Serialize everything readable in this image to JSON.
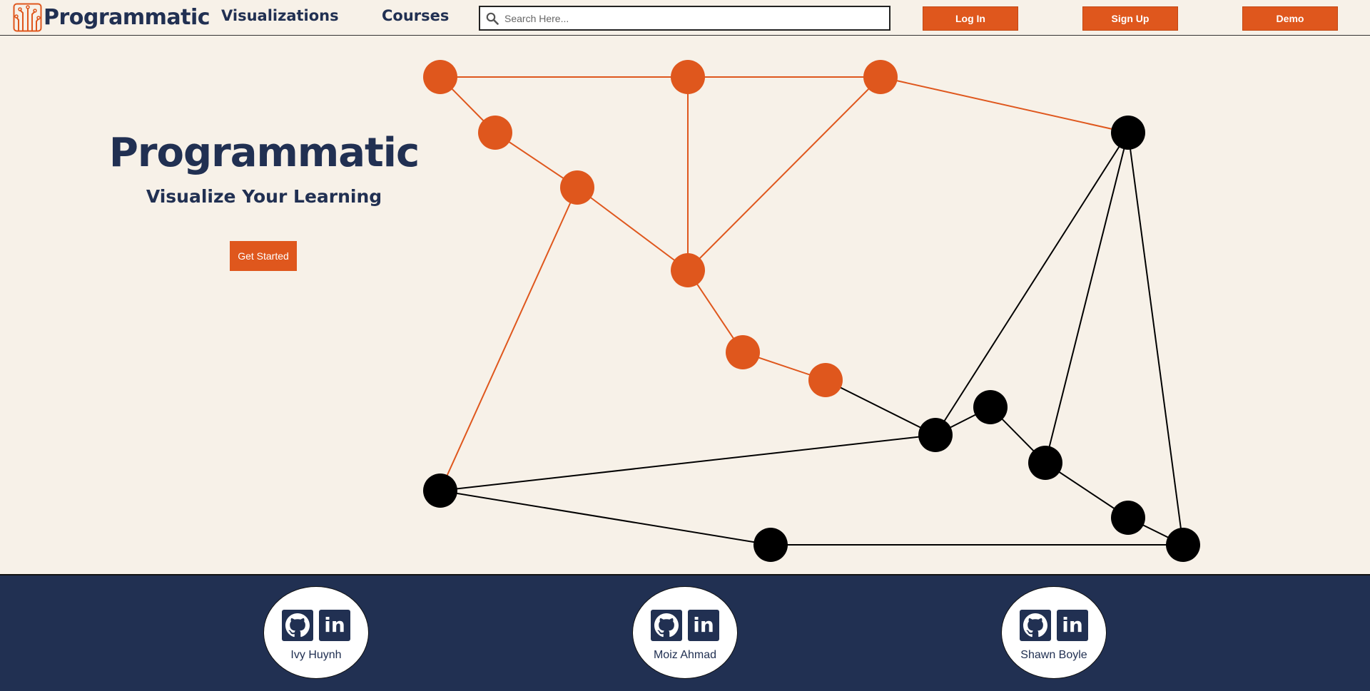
{
  "navbar": {
    "brand": "Programmatic",
    "links": [
      "Visualizations",
      "Courses"
    ],
    "search_placeholder": "Search Here...",
    "login_label": "Log In",
    "signup_label": "Sign Up",
    "demo_label": "Demo"
  },
  "hero": {
    "title": "Programmatic",
    "subtitle": "Visualize Your Learning",
    "cta_label": "Get Started"
  },
  "team": [
    {
      "name": "Ivy Huynh",
      "icons": [
        "github-icon",
        "linkedin-icon"
      ]
    },
    {
      "name": "Moiz Ahmad",
      "icons": [
        "github-icon",
        "linkedin-icon"
      ]
    },
    {
      "name": "Shawn Boyle",
      "icons": [
        "github-icon",
        "linkedin-icon"
      ]
    }
  ],
  "colors": {
    "accent": "#df571d",
    "navy": "#213052",
    "background": "#f7f1e8",
    "visited_node": "#df571d",
    "unvisited_node": "#000000"
  }
}
